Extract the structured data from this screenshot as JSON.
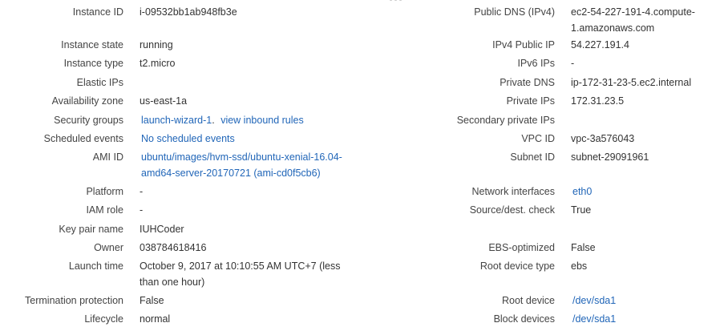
{
  "left": [
    {
      "label": "Instance ID",
      "value": "i-09532bb1ab948fb3e"
    },
    {
      "label": "Instance state",
      "value": "running"
    },
    {
      "label": "Instance type",
      "value": "t2.micro"
    },
    {
      "label": "Elastic IPs",
      "value": ""
    },
    {
      "label": "Availability zone",
      "value": "us-east-1a"
    },
    {
      "label": "Security groups",
      "link1": "launch-wizard-1",
      "sep": ".",
      "link2": "view inbound rules"
    },
    {
      "label": "Scheduled events",
      "value": "No scheduled events"
    },
    {
      "label": "AMI ID",
      "line1": "ubuntu/images/hvm-ssd/ubuntu-xenial-16.04-",
      "line2": "amd64-server-20170721 (ami-cd0f5cb6)"
    },
    {
      "label": "Platform",
      "value": "-"
    },
    {
      "label": "IAM role",
      "value": "-"
    },
    {
      "label": "Key pair name",
      "value": "IUHCoder"
    },
    {
      "label": "Owner",
      "value": "038784618416"
    },
    {
      "label": "Launch time",
      "line1": "October 9, 2017 at 10:10:55 AM UTC+7 (less",
      "line2": "than one hour)"
    },
    {
      "label": "Termination protection",
      "value": "False"
    },
    {
      "label": "Lifecycle",
      "value": "normal"
    }
  ],
  "right": [
    {
      "label": "Public DNS (IPv4)",
      "line1": "ec2-54-227-191-4.compute-",
      "line2": "1.amazonaws.com"
    },
    {
      "label": "IPv4 Public IP",
      "value": "54.227.191.4"
    },
    {
      "label": "IPv6 IPs",
      "value": "-"
    },
    {
      "label": "Private DNS",
      "value": "ip-172-31-23-5.ec2.internal"
    },
    {
      "label": "Private IPs",
      "value": "172.31.23.5"
    },
    {
      "label": "Secondary private IPs",
      "value": ""
    },
    {
      "label": "VPC ID",
      "value": "vpc-3a576043"
    },
    {
      "label": "Subnet ID",
      "value": "subnet-29091961"
    },
    {
      "label": "Network interfaces",
      "value": "eth0"
    },
    {
      "label": "Source/dest. check",
      "value": "True"
    },
    {
      "label": "EBS-optimized",
      "value": "False"
    },
    {
      "label": "Root device type",
      "value": "ebs"
    },
    {
      "label": "Root device",
      "value": "/dev/sda1"
    },
    {
      "label": "Block devices",
      "value": "/dev/sda1"
    }
  ],
  "colors": {
    "link": "#2166b8",
    "text": "#333333",
    "label": "#444444"
  }
}
